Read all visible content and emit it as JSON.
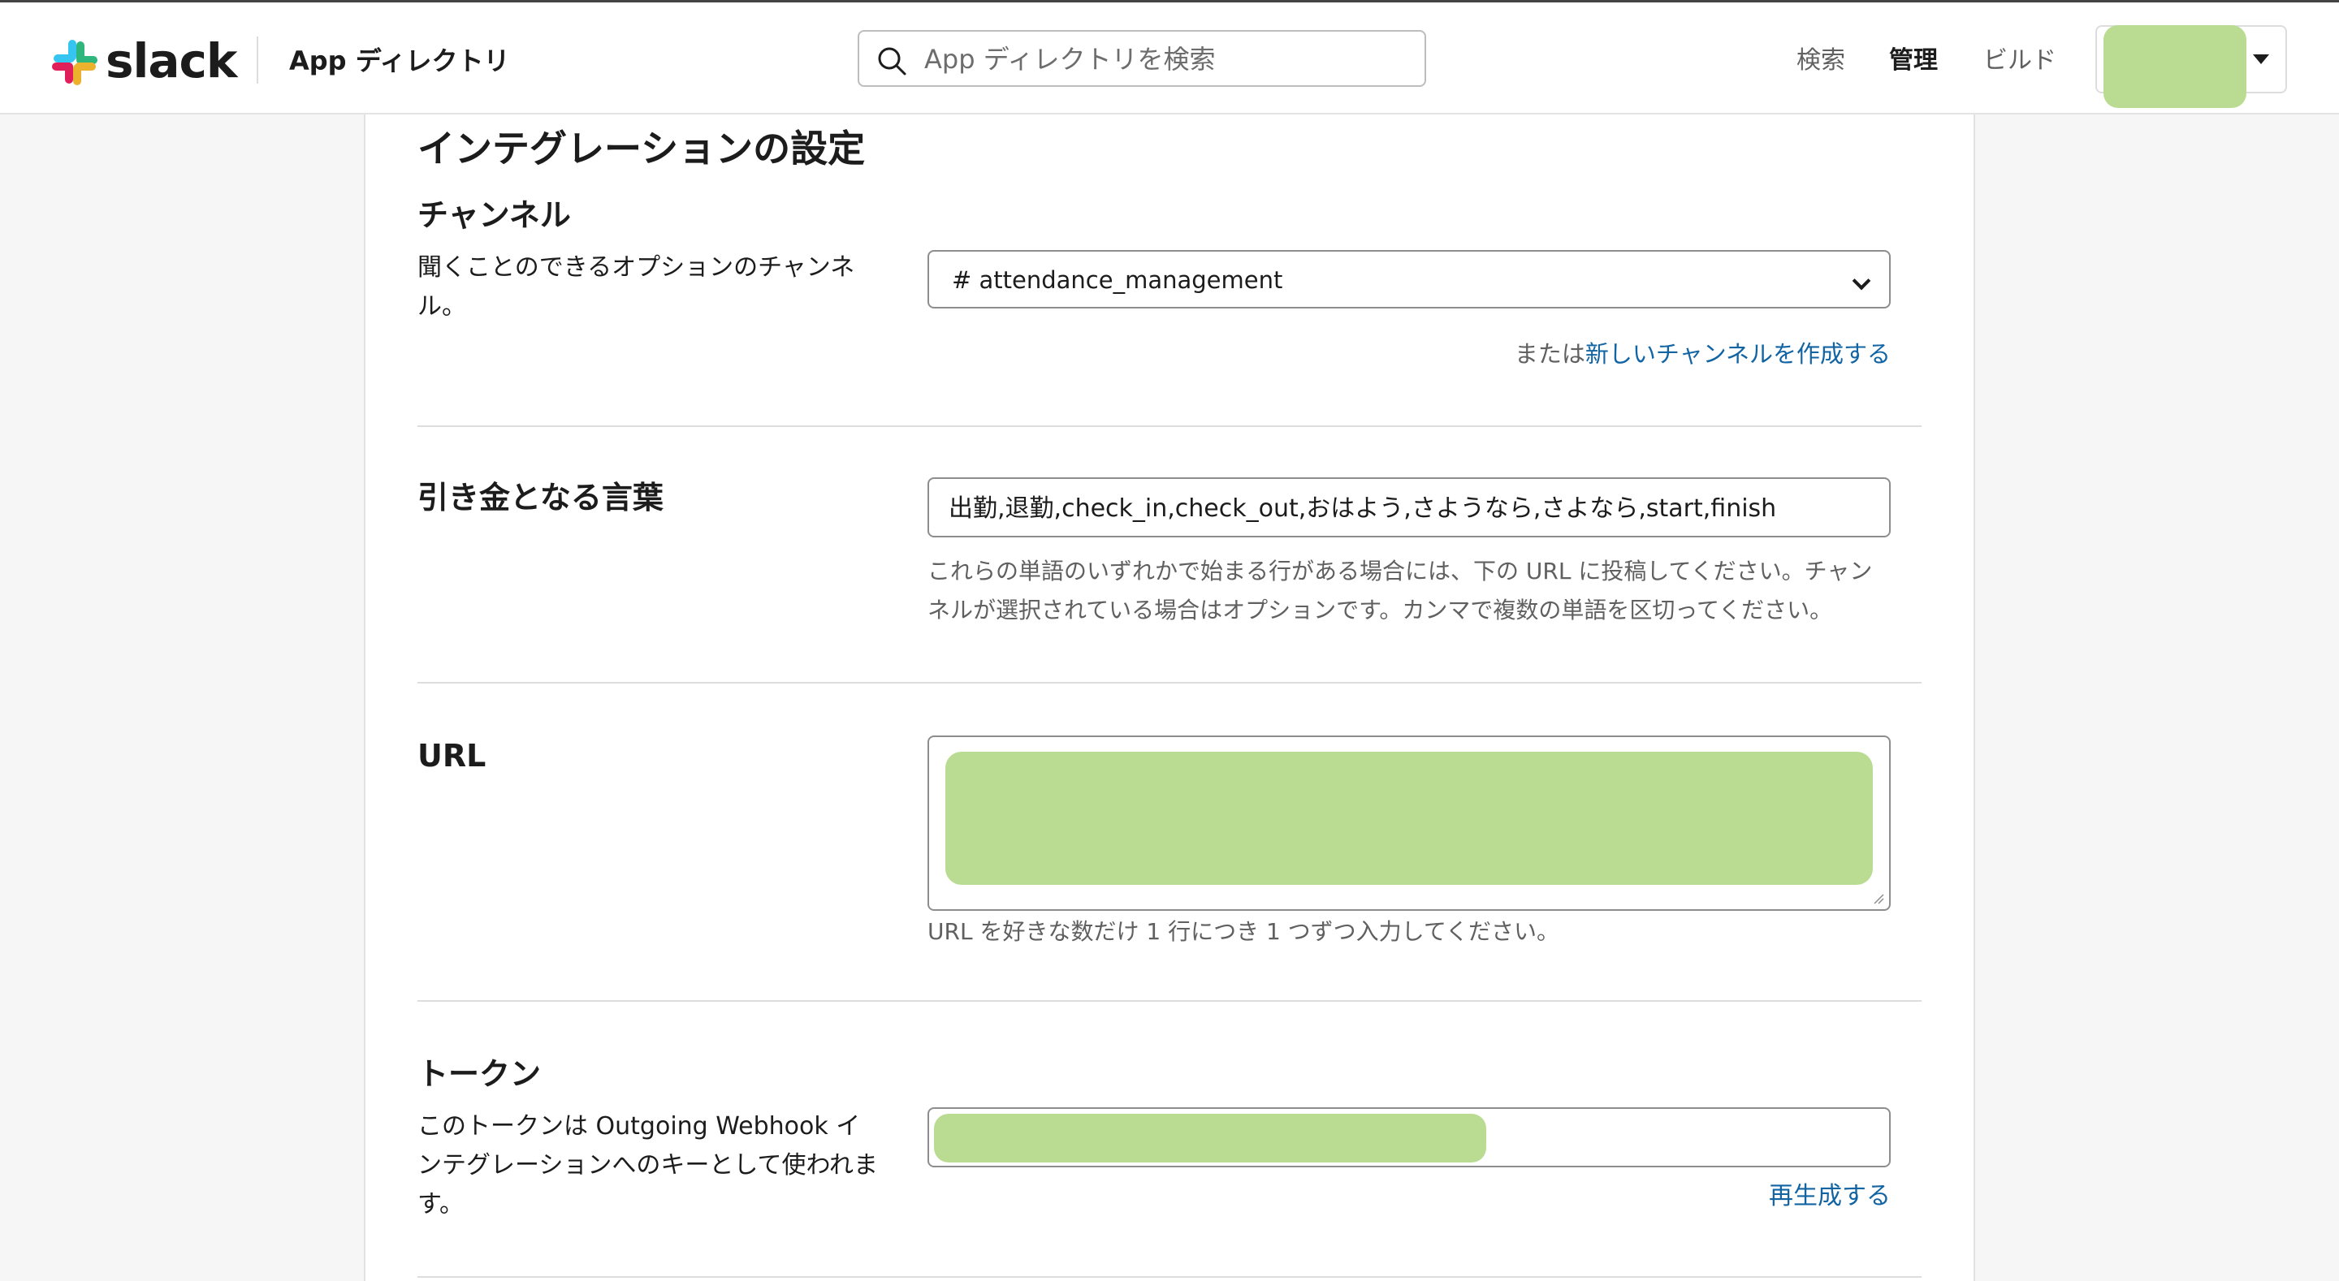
{
  "header": {
    "logo_text": "slack",
    "title": "App ディレクトリ",
    "search_placeholder": "App ディレクトリを検索",
    "nav": [
      "検索",
      "管理",
      "ビルド"
    ],
    "active_nav": "管理"
  },
  "page": {
    "title": "インテグレーションの設定"
  },
  "channel": {
    "label": "チャンネル",
    "description": "聞くことのできるオプションのチャンネル。",
    "selected": "# attendance_management",
    "or_text": "または",
    "create_link": "新しいチャンネルを作成する"
  },
  "trigger": {
    "label": "引き金となる言葉",
    "value": "出勤,退勤,check_in,check_out,おはよう,さようなら,さよなら,start,finish",
    "help": "これらの単語のいずれかで始まる行がある場合には、下の URL に投稿してください。チャンネルが選択されている場合はオプションです。カンマで複数の単語を区切ってください。"
  },
  "url": {
    "label": "URL",
    "help": "URL を好きな数だけ 1 行につき 1 つずつ入力してください。"
  },
  "token": {
    "label": "トークン",
    "description": "このトークンは Outgoing Webhook インテグレーションへのキーとして使われます。",
    "regenerate": "再生成する"
  },
  "colors": {
    "link": "#1264a3",
    "redaction": "#b9dc92"
  }
}
